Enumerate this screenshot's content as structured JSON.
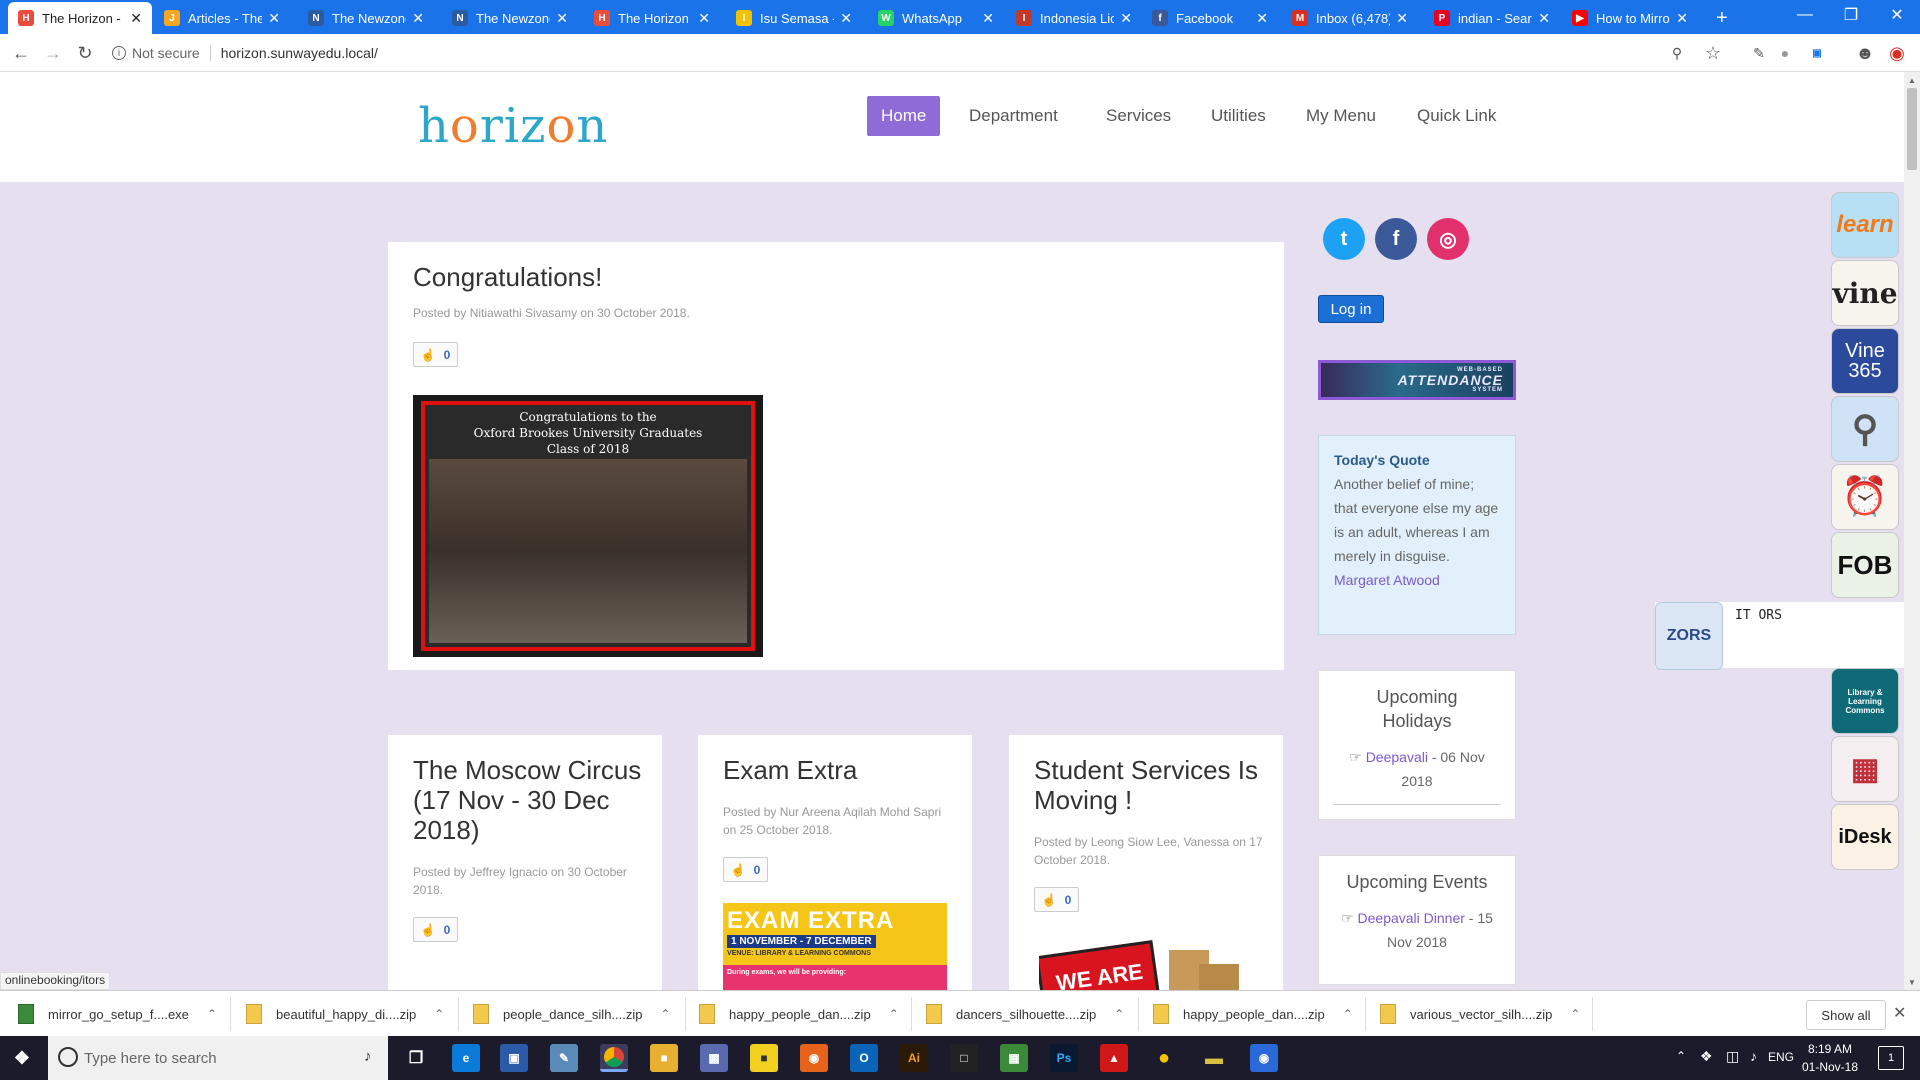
{
  "browser": {
    "tabs": [
      {
        "title": "The Horizon -",
        "fav": "H",
        "color": "#e94e3c",
        "active": true
      },
      {
        "title": "Articles - The",
        "fav": "J",
        "color": "#f5a623"
      },
      {
        "title": "The Newzone",
        "fav": "N",
        "color": "#2c5aa0"
      },
      {
        "title": "The Newzone",
        "fav": "N",
        "color": "#2c5aa0"
      },
      {
        "title": "The Horizon",
        "fav": "H",
        "color": "#e94e3c"
      },
      {
        "title": "Isu Semasa - S",
        "fav": "I",
        "color": "#f2c200"
      },
      {
        "title": "WhatsApp",
        "fav": "W",
        "color": "#25d366"
      },
      {
        "title": "Indonesia Lion",
        "fav": "I",
        "color": "#c0392b"
      },
      {
        "title": "Facebook",
        "fav": "f",
        "color": "#3b5998"
      },
      {
        "title": "Inbox (6,478)",
        "fav": "M",
        "color": "#d93025"
      },
      {
        "title": "indian - Search",
        "fav": "P",
        "color": "#e60023"
      },
      {
        "title": "How to Mirror",
        "fav": "▶",
        "color": "#ff0000"
      }
    ],
    "new_tab": "+",
    "not_secure": "Not secure",
    "url": "horizon.sunwayedu.local/"
  },
  "site": {
    "logo": "horizon",
    "menu": [
      "Home",
      "Department",
      "Services",
      "Utilities",
      "My Menu",
      "Quick Link"
    ]
  },
  "featured": {
    "title": "Congratulations!",
    "meta": "Posted by Nitiawathi Sivasamy on 30 October 2018.",
    "likes": "0",
    "image_caption": [
      "Congratulations to the",
      "Oxford Brookes University Graduates",
      "Class of 2018"
    ]
  },
  "posts": [
    {
      "title": "The Moscow Circus (17 Nov - 30 Dec 2018)",
      "meta": "Posted by Jeffrey Ignacio on 30 October 2018.",
      "likes": "0"
    },
    {
      "title": "Exam Extra",
      "meta": "Posted by Nur Areena Aqilah Mohd Sapri on 25 October 2018.",
      "likes": "0",
      "banner_title": "EXAM EXTRA",
      "banner_date": "1 NOVEMBER - 7 DECEMBER",
      "banner_venue": "VENUE: LIBRARY & LEARNING COMMONS",
      "banner_note": "During exams, we will be providing:"
    },
    {
      "title": "Student Services Is Moving !",
      "meta": "Posted by Leong Siow Lee, Vanessa on 17 October 2018.",
      "likes": "0",
      "sign_text": "WE ARE"
    }
  ],
  "sidebar": {
    "login": "Log in",
    "attendance": "ATTENDANCE",
    "attendance_small_1": "WEB-BASED",
    "attendance_small_2": "SYSTEM",
    "quote_heading": "Today's Quote",
    "quote_text": "Another belief of mine; that everyone else my age is an adult, whereas I am merely in disguise.",
    "quote_author": "Margaret Atwood",
    "holidays_title": "Upcoming Holidays",
    "holiday_link": "Deepavali",
    "holiday_date": " - 06 Nov 2018",
    "events_title": "Upcoming Events",
    "event_link": "Deepavali Dinner",
    "event_date": " - 15 Nov 2018"
  },
  "apps": {
    "learn": "learn",
    "vine": "vine",
    "vine365": "Vine 365",
    "fob": "FOB",
    "library": "Library & Learning Commons",
    "idesk": "iDesk",
    "itors_label": "IT ORS",
    "itors_icon": "ZORS"
  },
  "status_url": "onlinebooking/itors",
  "downloads": [
    {
      "name": "mirror_go_setup_f....exe"
    },
    {
      "name": "beautiful_happy_di....zip"
    },
    {
      "name": "people_dance_silh....zip"
    },
    {
      "name": "happy_people_dan....zip"
    },
    {
      "name": "dancers_silhouette....zip"
    },
    {
      "name": "happy_people_dan....zip"
    },
    {
      "name": "various_vector_silh....zip"
    }
  ],
  "show_all": "Show all",
  "taskbar": {
    "search_placeholder": "Type here to search",
    "lang": "ENG",
    "time": "8:19 AM",
    "date": "01-Nov-18",
    "notif_count": "1"
  }
}
